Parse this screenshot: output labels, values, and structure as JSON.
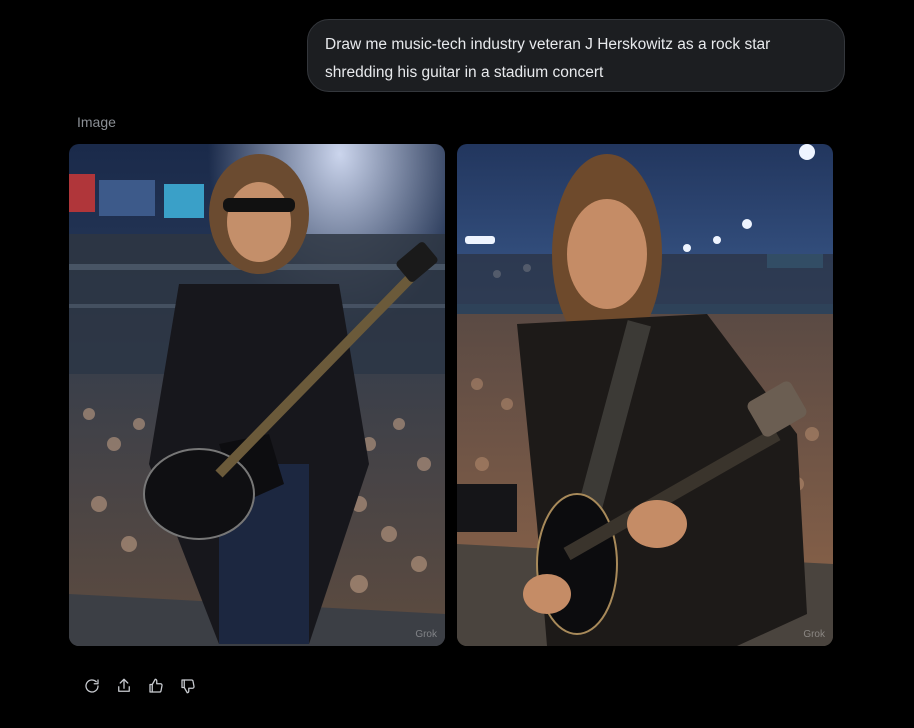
{
  "prompt": {
    "text": "Draw me music-tech industry veteran J Herskowitz as a rock star shredding his guitar in a stadium concert"
  },
  "result": {
    "section_label": "Image",
    "images": [
      {
        "watermark": "Grok"
      },
      {
        "watermark": "Grok"
      }
    ]
  },
  "actions": {
    "icons": [
      "regenerate-icon",
      "share-icon",
      "thumbs-up-icon",
      "thumbs-down-icon"
    ]
  }
}
